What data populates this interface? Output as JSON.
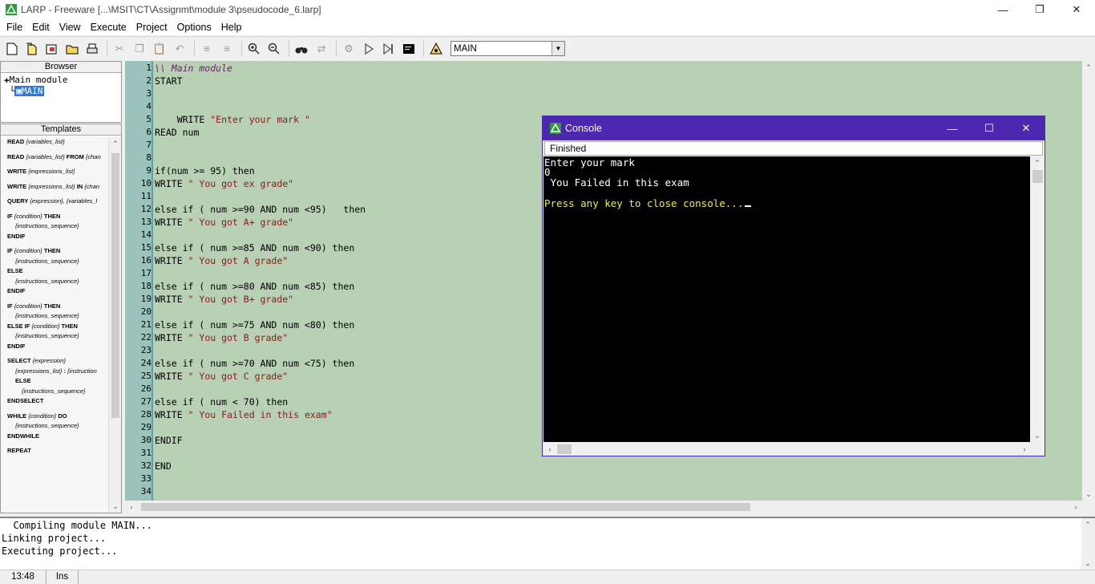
{
  "window": {
    "title": "LARP - Freeware [...\\MSIT\\CT\\Assignmt\\module 3\\pseudocode_6.larp]",
    "minimize": "—",
    "maximize": "❐",
    "close": "✕"
  },
  "menu": [
    "File",
    "Edit",
    "View",
    "Execute",
    "Project",
    "Options",
    "Help"
  ],
  "toolbar": {
    "module_select": "MAIN"
  },
  "browser": {
    "header": "Browser",
    "root": "Main module",
    "selected": "MAIN"
  },
  "templates": {
    "header": "Templates",
    "items": [
      [
        [
          "b",
          "READ "
        ],
        [
          "i",
          "{variables_list}"
        ]
      ],
      [
        [
          "b",
          "READ "
        ],
        [
          "i",
          "{variables_list}"
        ],
        [
          "b",
          " FROM "
        ],
        [
          "i",
          "{chan"
        ]
      ],
      [
        [
          "b",
          "WRITE "
        ],
        [
          "i",
          "{expressions_list}"
        ]
      ],
      [
        [
          "b",
          "WRITE "
        ],
        [
          "i",
          "{expressions_list}"
        ],
        [
          "b",
          " IN "
        ],
        [
          "i",
          "{chan"
        ]
      ],
      [
        [
          "b",
          "QUERY "
        ],
        [
          "i",
          "{expression}, {variables_l"
        ]
      ]
    ],
    "blocks": [
      [
        "IF {condition} THEN",
        "  {instructions_sequence}",
        "ENDIF"
      ],
      [
        "IF {condition} THEN",
        "  {instructions_sequence}",
        "ELSE",
        "  {instructions_sequence}",
        "ENDIF"
      ],
      [
        "IF {condition} THEN",
        "  {instructions_sequence}",
        "ELSE IF {condition} THEN",
        "  {instructions_sequence}",
        "ENDIF"
      ],
      [
        "SELECT {expression}",
        "  {expressions_list} : {instruction",
        "  ELSE",
        "    {instructions_sequence}",
        "ENDSELECT"
      ],
      [
        "WHILE {condition} DO",
        "  {instructions_sequence}",
        "ENDWHILE"
      ],
      [
        "REPEAT"
      ]
    ]
  },
  "editor": {
    "lines": [
      [
        [
          "cmt",
          "\\\\ Main module"
        ]
      ],
      [
        [
          "",
          "START"
        ]
      ],
      [
        [
          "",
          ""
        ]
      ],
      [
        [
          "",
          ""
        ]
      ],
      [
        [
          "",
          "    WRITE "
        ],
        [
          "str",
          "\"Enter your mark \""
        ]
      ],
      [
        [
          "",
          "READ num"
        ]
      ],
      [
        [
          "",
          ""
        ]
      ],
      [
        [
          "",
          ""
        ]
      ],
      [
        [
          "",
          "if(num >= 95) then"
        ]
      ],
      [
        [
          "",
          "WRITE "
        ],
        [
          "str",
          "\" You got ex grade\""
        ]
      ],
      [
        [
          "",
          ""
        ]
      ],
      [
        [
          "",
          "else if ( num >=90 AND num <95)   then"
        ]
      ],
      [
        [
          "",
          "WRITE "
        ],
        [
          "str",
          "\" You got A+ grade\""
        ]
      ],
      [
        [
          "",
          ""
        ]
      ],
      [
        [
          "",
          "else if ( num >=85 AND num <90) then"
        ]
      ],
      [
        [
          "",
          "WRITE "
        ],
        [
          "str",
          "\" You got A grade\""
        ]
      ],
      [
        [
          "",
          ""
        ]
      ],
      [
        [
          "",
          "else if ( num >=80 AND num <85) then"
        ]
      ],
      [
        [
          "",
          "WRITE "
        ],
        [
          "str",
          "\" You got B+ grade\""
        ]
      ],
      [
        [
          "",
          ""
        ]
      ],
      [
        [
          "",
          "else if ( num >=75 AND num <80) then"
        ]
      ],
      [
        [
          "",
          "WRITE "
        ],
        [
          "str",
          "\" You got B grade\""
        ]
      ],
      [
        [
          "",
          ""
        ]
      ],
      [
        [
          "",
          "else if ( num >=70 AND num <75) then"
        ]
      ],
      [
        [
          "",
          "WRITE "
        ],
        [
          "str",
          "\" You got C grade\""
        ]
      ],
      [
        [
          "",
          ""
        ]
      ],
      [
        [
          "",
          "else if ( num < 70) then"
        ]
      ],
      [
        [
          "",
          "WRITE "
        ],
        [
          "str",
          "\" You Failed in this exam\""
        ]
      ],
      [
        [
          "",
          ""
        ]
      ],
      [
        [
          "",
          "ENDIF"
        ]
      ],
      [
        [
          "",
          ""
        ]
      ],
      [
        [
          "",
          "END"
        ]
      ],
      [
        [
          "",
          ""
        ]
      ],
      [
        [
          "",
          ""
        ]
      ]
    ]
  },
  "output": [
    "  Compiling module MAIN...",
    "Linking project...",
    "Executing project..."
  ],
  "status": {
    "position": "13:48",
    "mode": "Ins"
  },
  "console": {
    "title": "Console",
    "status": "Finished",
    "lines": [
      {
        "text": "Enter your mark",
        "color": "white"
      },
      {
        "text": "0",
        "color": "white"
      },
      {
        "text": " You Failed in this exam",
        "color": "white"
      },
      {
        "text": "",
        "color": "white"
      },
      {
        "text": "Press any key to close console...",
        "color": "yellow"
      }
    ],
    "minimize": "—",
    "maximize": "☐",
    "close": "✕"
  }
}
